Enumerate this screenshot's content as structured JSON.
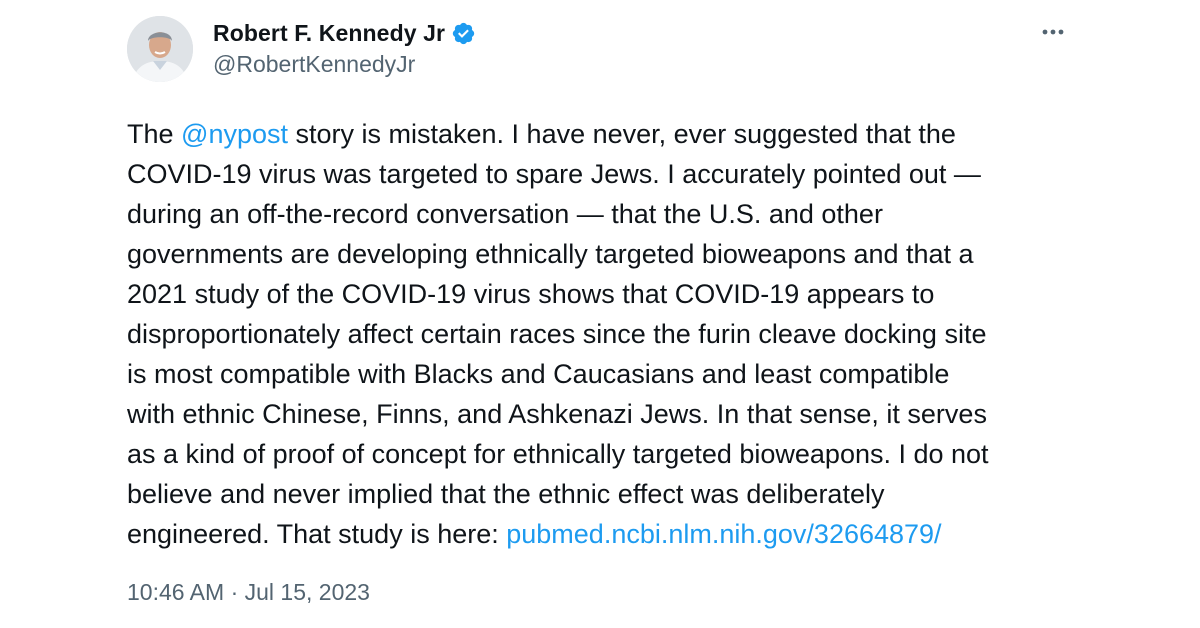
{
  "author": {
    "display_name": "Robert F. Kennedy Jr",
    "handle": "@RobertKennedyJr",
    "verified_icon": "verified-badge-icon",
    "avatar_icon": "avatar-photo"
  },
  "menu": {
    "more_icon": "more-horizontal-icon"
  },
  "tweet": {
    "part1": "The ",
    "mention": "@nypost",
    "part2": " story is mistaken. I have never, ever suggested that the\nCOVID-19 virus was targeted to spare Jews. I accurately pointed out —\nduring an off-the-record conversation — that the U.S. and other\ngovernments are developing ethnically targeted bioweapons and that a\n2021 study of the COVID-19 virus shows that COVID-19 appears to\ndisproportionately affect certain races since the furin cleave docking site\nis most compatible with Blacks and Caucasians and least compatible\nwith ethnic Chinese, Finns, and Ashkenazi Jews. In that sense, it serves\nas a kind of proof of concept for ethnically targeted bioweapons. I do not\nbelieve and never implied that the ethnic effect was deliberately\nengineered. That study is here: ",
    "link": "pubmed.ncbi.nlm.nih.gov/32664879/"
  },
  "timestamp": "10:46 AM · Jul 15, 2023",
  "colors": {
    "link": "#1d9bf0",
    "secondary_text": "#536471",
    "primary_text": "#0f1419"
  }
}
